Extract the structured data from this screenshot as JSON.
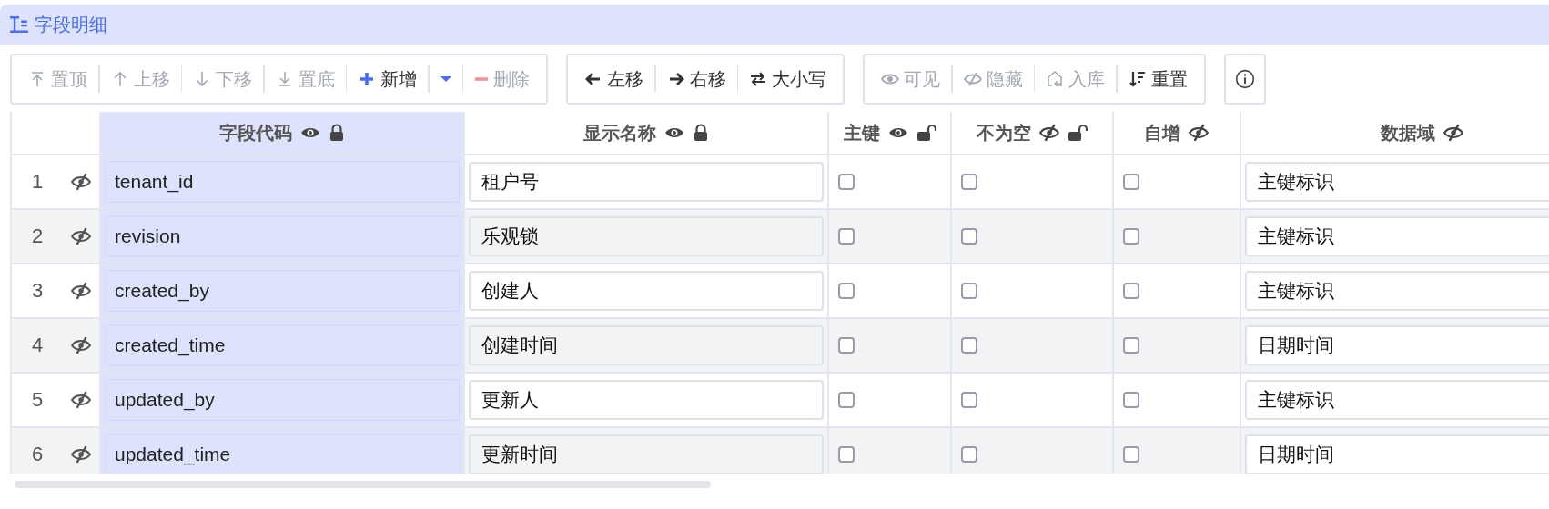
{
  "panel": {
    "title": "字段明细"
  },
  "toolbar": [
    {
      "buttons": [
        {
          "kind": "action",
          "label": "置顶",
          "disabled": true
        },
        {
          "kind": "action",
          "label": "上移",
          "disabled": true
        },
        {
          "kind": "action",
          "label": "下移",
          "disabled": true
        },
        {
          "kind": "action",
          "label": "置底",
          "disabled": true
        },
        {
          "kind": "action",
          "label": "新增",
          "disabled": false
        },
        {
          "kind": "dropdown",
          "disabled": false
        },
        {
          "kind": "action",
          "label": "删除",
          "disabled": true
        }
      ]
    },
    {
      "buttons": [
        {
          "kind": "action",
          "label": "左移",
          "disabled": false
        },
        {
          "kind": "action",
          "label": "右移",
          "disabled": false
        },
        {
          "kind": "action",
          "label": "大小写",
          "disabled": false
        }
      ]
    },
    {
      "buttons": [
        {
          "kind": "action",
          "label": "可见",
          "disabled": true
        },
        {
          "kind": "action",
          "label": "隐藏",
          "disabled": true
        },
        {
          "kind": "action",
          "label": "入库",
          "disabled": true
        },
        {
          "kind": "action",
          "label": "重置",
          "disabled": false
        }
      ]
    }
  ],
  "table": {
    "columns": [
      {
        "label": "字段代码",
        "visible": true,
        "locked": true,
        "selected": true
      },
      {
        "label": "显示名称",
        "visible": true,
        "locked": true,
        "selected": false
      },
      {
        "label": "主键",
        "visible": true,
        "locked": false,
        "selected": false
      },
      {
        "label": "不为空",
        "visible": false,
        "locked": false,
        "selected": false
      },
      {
        "label": "自增",
        "visible": false,
        "selected": false
      },
      {
        "label": "数据域",
        "visible": false,
        "selected": false
      }
    ],
    "rows": [
      {
        "number": "1",
        "visible": false,
        "code": "tenant_id",
        "name": "租户号",
        "primary_key": false,
        "not_null": false,
        "auto_increment": false,
        "domain": "主键标识"
      },
      {
        "number": "2",
        "visible": false,
        "code": "revision",
        "name": "乐观锁",
        "primary_key": false,
        "not_null": false,
        "auto_increment": false,
        "domain": "主键标识"
      },
      {
        "number": "3",
        "visible": false,
        "code": "created_by",
        "name": "创建人",
        "primary_key": false,
        "not_null": false,
        "auto_increment": false,
        "domain": "主键标识"
      },
      {
        "number": "4",
        "visible": false,
        "code": "created_time",
        "name": "创建时间",
        "primary_key": false,
        "not_null": false,
        "auto_increment": false,
        "domain": "日期时间"
      },
      {
        "number": "5",
        "visible": false,
        "code": "updated_by",
        "name": "更新人",
        "primary_key": false,
        "not_null": false,
        "auto_increment": false,
        "domain": "主键标识"
      },
      {
        "number": "6",
        "visible": false,
        "code": "updated_time",
        "name": "更新时间",
        "primary_key": false,
        "not_null": false,
        "auto_increment": false,
        "domain": "日期时间"
      }
    ]
  }
}
